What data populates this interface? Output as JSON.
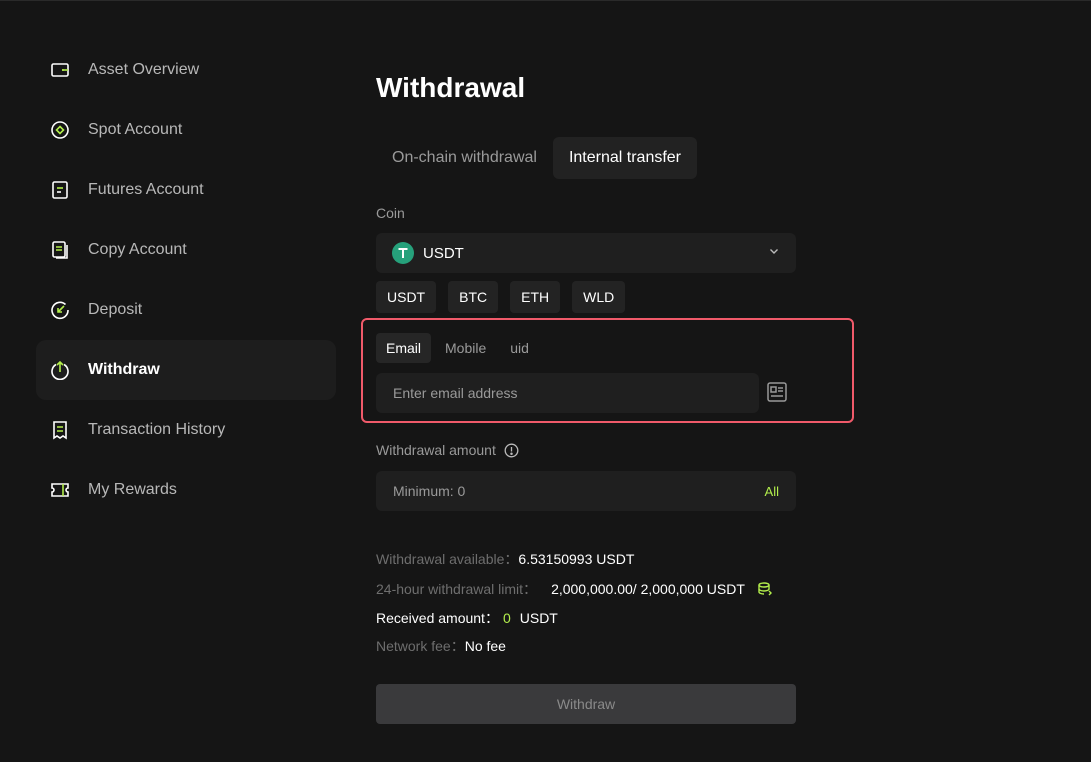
{
  "sidebar": {
    "items": [
      {
        "label": "Asset Overview",
        "icon": "wallet-icon"
      },
      {
        "label": "Spot Account",
        "icon": "spot-icon"
      },
      {
        "label": "Futures Account",
        "icon": "futures-icon"
      },
      {
        "label": "Copy Account",
        "icon": "copy-icon"
      },
      {
        "label": "Deposit",
        "icon": "deposit-icon"
      },
      {
        "label": "Withdraw",
        "icon": "withdraw-icon",
        "active": true
      },
      {
        "label": "Transaction History",
        "icon": "receipt-icon"
      },
      {
        "label": "My Rewards",
        "icon": "rewards-icon"
      }
    ]
  },
  "main": {
    "title": "Withdrawal",
    "tabs": [
      {
        "label": "On-chain withdrawal"
      },
      {
        "label": "Internal transfer",
        "active": true
      }
    ],
    "coin": {
      "label": "Coin",
      "selected": "USDT",
      "icon": "tether-icon",
      "quick": [
        "USDT",
        "BTC",
        "ETH",
        "WLD"
      ]
    },
    "recipient": {
      "methods": [
        {
          "label": "Email",
          "active": true
        },
        {
          "label": "Mobile"
        },
        {
          "label": "uid"
        }
      ],
      "placeholder": "Enter email address",
      "value": "",
      "contact_icon": "address-book-icon"
    },
    "amount": {
      "label": "Withdrawal amount",
      "placeholder": "Minimum: 0",
      "all_label": "All"
    },
    "info": {
      "available_label": "Withdrawal available：",
      "available_value": "6.53150993 USDT",
      "limit_label": "24-hour withdrawal limit：",
      "limit_value": "2,000,000.00/ 2,000,000 USDT",
      "received_label": "Received amount：",
      "received_value": "0",
      "received_unit": "USDT",
      "fee_label": "Network fee：",
      "fee_value": "No fee"
    },
    "submit_label": "Withdraw"
  },
  "colors": {
    "background": "#151515",
    "accent": "#b3ee4c",
    "highlight_border": "#f05a6a",
    "tether": "#26a17b"
  }
}
